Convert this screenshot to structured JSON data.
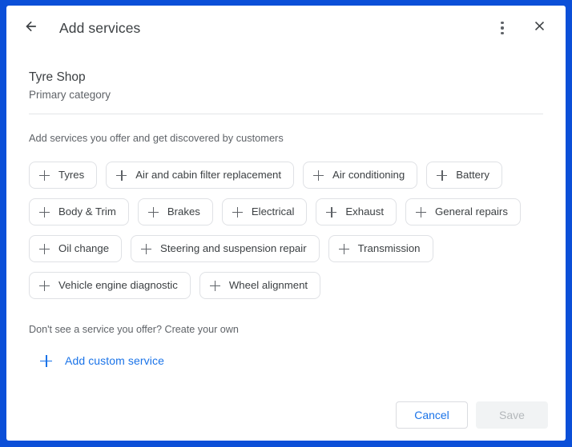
{
  "header": {
    "back_icon": "arrow-left-icon",
    "title": "Add services",
    "overflow_icon": "more-vert-icon",
    "close_icon": "close-icon"
  },
  "category": {
    "name": "Tyre Shop",
    "subtitle": "Primary category"
  },
  "body": {
    "hint": "Add services you offer and get discovered by customers",
    "service_rows": [
      [
        {
          "label": "Tyres"
        },
        {
          "label": "Air and cabin filter replacement"
        },
        {
          "label": "Air conditioning"
        },
        {
          "label": "Battery"
        }
      ],
      [
        {
          "label": "Body & Trim"
        },
        {
          "label": "Brakes"
        },
        {
          "label": "Electrical"
        },
        {
          "label": "Exhaust"
        },
        {
          "label": "General repairs"
        }
      ],
      [
        {
          "label": "Oil change"
        },
        {
          "label": "Steering and suspension repair"
        },
        {
          "label": "Transmission"
        }
      ],
      [
        {
          "label": "Vehicle engine diagnostic"
        },
        {
          "label": "Wheel alignment"
        }
      ]
    ],
    "custom_note": "Don't see a service you offer? Create your own",
    "custom_link_label": "Add custom service"
  },
  "footer": {
    "cancel_label": "Cancel",
    "save_label": "Save",
    "save_disabled": true
  },
  "colors": {
    "frame_blue": "#0b4fd8",
    "link_blue": "#1a73e8",
    "text_primary": "#3c4043",
    "text_secondary": "#5f6368",
    "chip_border": "#dfe1e5",
    "save_disabled_bg": "#f1f3f4",
    "save_disabled_text": "#b4b8bb"
  }
}
